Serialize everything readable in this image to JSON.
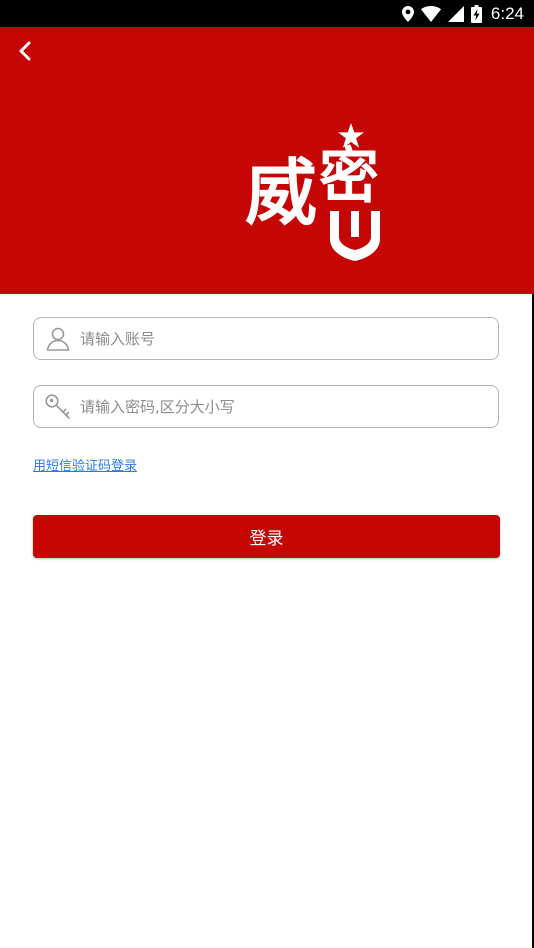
{
  "status_bar": {
    "time": "6:24",
    "icons": [
      "location-icon",
      "wifi-icon",
      "signal-icon",
      "battery-charging-icon"
    ]
  },
  "header": {
    "back_icon": "chevron-left-icon",
    "background_color": "#c50605",
    "logo": {
      "char_1": "威",
      "char_2": "密"
    }
  },
  "form": {
    "account": {
      "placeholder": "请输入账号",
      "value": "",
      "icon": "user-icon"
    },
    "password": {
      "placeholder": "请输入密码,区分大小写",
      "value": "",
      "icon": "key-icon"
    },
    "sms_login_link": "用短信验证码登录",
    "submit_label": "登录"
  },
  "colors": {
    "accent": "#c50605",
    "link": "#2a7ae2"
  }
}
